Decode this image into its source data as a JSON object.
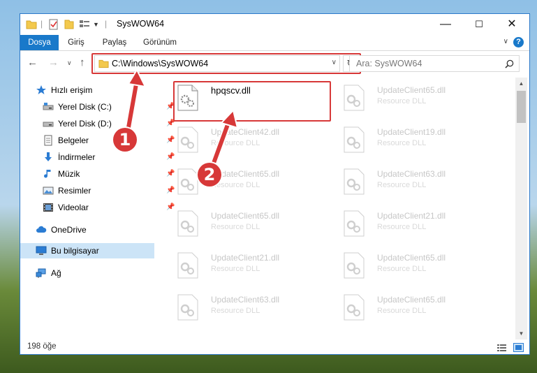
{
  "window": {
    "title": "SysWOW64",
    "minimize": "—",
    "maximize": "☐",
    "close": "✕"
  },
  "ribbon": {
    "tabs": [
      "Dosya",
      "Giriş",
      "Paylaş",
      "Görünüm"
    ],
    "help": "?"
  },
  "nav": {
    "address": "C:\\Windows\\SysWOW64",
    "search_placeholder": "Ara: SysWOW64"
  },
  "sidebar": {
    "quick_access": "Hızlı erişim",
    "items": [
      {
        "label": "Yerel Disk (C:)",
        "pinned": true
      },
      {
        "label": "Yerel Disk (D:)",
        "pinned": true
      },
      {
        "label": "Belgeler",
        "pinned": true
      },
      {
        "label": "İndirmeler",
        "pinned": true
      },
      {
        "label": "Müzik",
        "pinned": true
      },
      {
        "label": "Resimler",
        "pinned": true
      },
      {
        "label": "Videolar",
        "pinned": true
      }
    ],
    "onedrive": "OneDrive",
    "this_pc": "Bu bilgisayar",
    "network": "Ağ"
  },
  "files": {
    "main": {
      "name": "hpqscv.dll",
      "type": ""
    },
    "left": [
      {
        "name": "UpdateClient42.dll",
        "type": "Resource DLL"
      },
      {
        "name": "UpdateClient65.dll",
        "type": "Resource DLL"
      },
      {
        "name": "UpdateClient65.dll",
        "type": "Resource DLL"
      },
      {
        "name": "UpdateClient21.dll",
        "type": "Resource DLL"
      },
      {
        "name": "UpdateClient63.dll",
        "type": "Resource DLL"
      }
    ],
    "right": [
      {
        "name": "UpdateClient65.dll",
        "type": "Resource DLL"
      },
      {
        "name": "UpdateClient19.dll",
        "type": "Resource DLL"
      },
      {
        "name": "UpdateClient63.dll",
        "type": "Resource DLL"
      },
      {
        "name": "UpdateClient21.dll",
        "type": "Resource DLL"
      },
      {
        "name": "UpdateClient65.dll",
        "type": "Resource DLL"
      },
      {
        "name": "UpdateClient65.dll",
        "type": "Resource DLL"
      }
    ]
  },
  "status": {
    "count": "198 öğe"
  },
  "annotations": {
    "step1": "1",
    "step2": "2"
  },
  "colors": {
    "accent": "#1979ca",
    "annotation": "#d73838",
    "selection": "#cce4f7"
  }
}
